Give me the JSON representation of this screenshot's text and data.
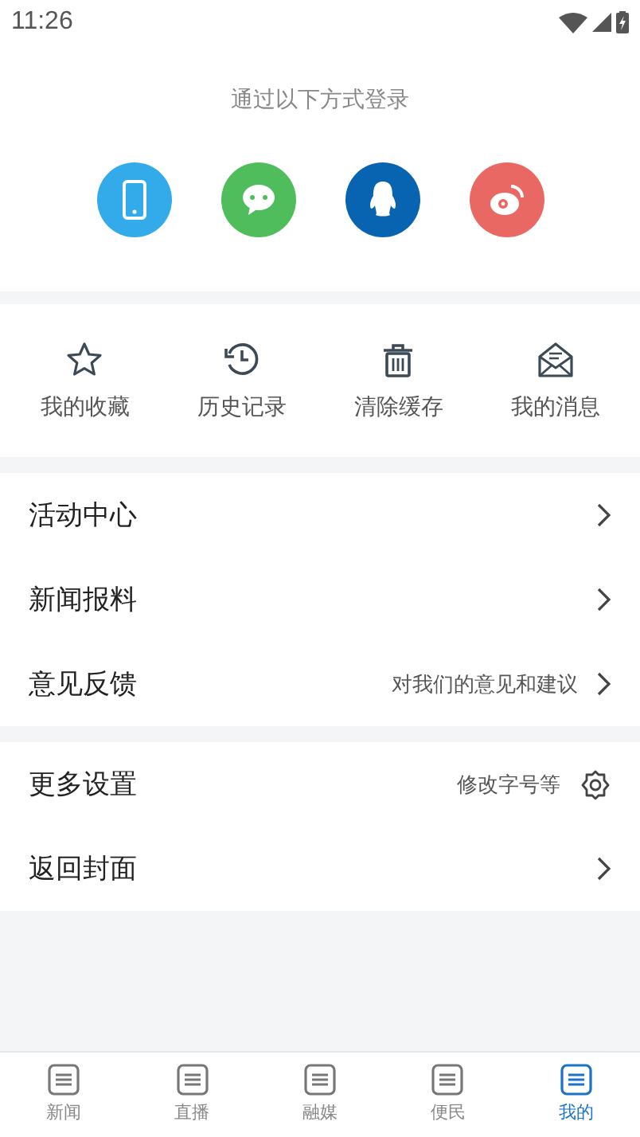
{
  "status_bar": {
    "time": "11:26"
  },
  "login": {
    "title": "通过以下方式登录",
    "methods": [
      {
        "kind": "phone",
        "color": "#33aaea"
      },
      {
        "kind": "wechat",
        "color": "#4fbd5b"
      },
      {
        "kind": "qq",
        "color": "#0863b1"
      },
      {
        "kind": "weibo",
        "color": "#ea6864"
      }
    ]
  },
  "shortcuts": [
    {
      "kind": "star",
      "label": "我的收藏"
    },
    {
      "kind": "history",
      "label": "历史记录"
    },
    {
      "kind": "trash",
      "label": "清除缓存"
    },
    {
      "kind": "mail",
      "label": "我的消息"
    }
  ],
  "menu_groups": [
    [
      {
        "kind": "chevron",
        "label": "活动中心"
      },
      {
        "kind": "chevron",
        "label": "新闻报料"
      },
      {
        "kind": "chevron",
        "label": "意见反馈",
        "hint": "对我们的意见和建议"
      }
    ],
    [
      {
        "kind": "gear",
        "label": "更多设置",
        "hint": "修改字号等"
      },
      {
        "kind": "chevron",
        "label": "返回封面"
      }
    ]
  ],
  "tab_bar": [
    {
      "label": "新闻",
      "selected": false
    },
    {
      "label": "直播",
      "selected": false
    },
    {
      "label": "融媒",
      "selected": false
    },
    {
      "label": "便民",
      "selected": false
    },
    {
      "label": "我的",
      "selected": true
    }
  ]
}
